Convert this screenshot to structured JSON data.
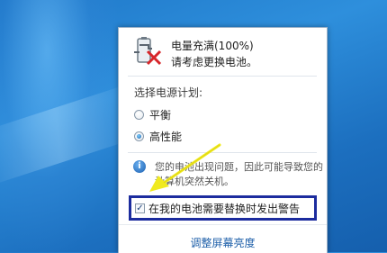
{
  "status": {
    "title": "电量充满(100%)",
    "subtitle": "请考虑更换电池。"
  },
  "power_plan": {
    "label": "选择电源计划:",
    "options": [
      {
        "label": "平衡",
        "selected": false
      },
      {
        "label": "高性能",
        "selected": true
      }
    ]
  },
  "notice": {
    "text": "您的电池出现问题，因此可能导致您的计算机突然关机。"
  },
  "warning_option": {
    "label": "在我的电池需要替换时发出警告",
    "checked": true
  },
  "footer": {
    "link": "调整屏幕亮度"
  },
  "colors": {
    "highlight_border": "#1c2c9e",
    "arrow": "#f0ea1f",
    "link": "#1e5fa9"
  },
  "icons": [
    "battery-warning-icon",
    "info-icon",
    "check-mark-icon",
    "pointer-arrow-icon"
  ]
}
